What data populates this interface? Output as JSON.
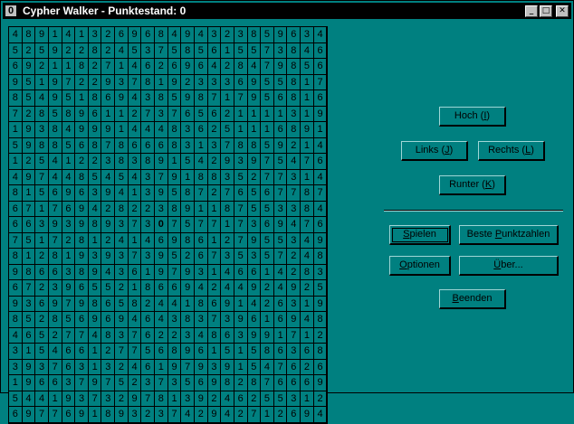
{
  "window": {
    "title": "Cypher Walker - Punktestand: 0",
    "system_menu_glyph": "0",
    "minimize_glyph": "_",
    "maximize_glyph": "□",
    "close_glyph": "✕"
  },
  "grid": {
    "rows": [
      "489141326968494323859634",
      "525922824537585615573846",
      "692118271462696428479856",
      "951972293781923336955817",
      "854951869438598717956816",
      "728589611273765621111319",
      "193849991444836251116891",
      "598856878666831378859214",
      "125412238389154293975476",
      "497448545437918835277314",
      "815696394139587276567787",
      "671769428223891187553384",
      "663939893730757717369476",
      "751728124146986127955349",
      "812819393739526735357248",
      "986638943619793146614283",
      "672396552186694244924925",
      "936979865824418691426319",
      "852856969464383739616948",
      "465277483762234863991712",
      "315466127756896151586368",
      "393763132461979391547626",
      "196637975237356982876669",
      "544193732978139246255312",
      "697769189323742942712694"
    ],
    "player_symbol": "0",
    "player_position_label": "row 13, column 17"
  },
  "buttons": {
    "up": {
      "pre": "Hoch (",
      "key": "I",
      "post": ")"
    },
    "left": {
      "pre": "Links (",
      "key": "J",
      "post": ")"
    },
    "right": {
      "pre": "Rechts (",
      "key": "L",
      "post": ")"
    },
    "down": {
      "pre": "Runter (",
      "key": "K",
      "post": ")"
    },
    "play": {
      "pre": "",
      "key": "S",
      "post": "pielen"
    },
    "highscores": {
      "pre": "Beste ",
      "key": "P",
      "post": "unktzahlen"
    },
    "options": {
      "pre": "",
      "key": "O",
      "post": "ptionen"
    },
    "about": {
      "pre": "",
      "key": "Ü",
      "post": "ber..."
    },
    "quit": {
      "pre": "",
      "key": "B",
      "post": "eenden"
    }
  }
}
